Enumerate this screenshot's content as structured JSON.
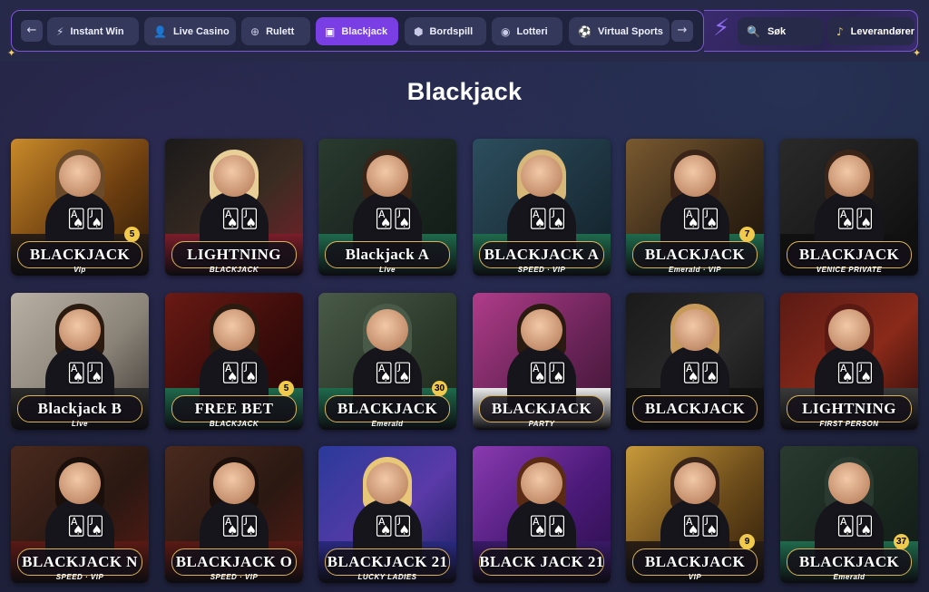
{
  "nav": {
    "prev_arrow": "←",
    "next_arrow": "→",
    "tabs": [
      {
        "label": "Instant Win",
        "icon": "⚡",
        "icon_name": "bolt-icon"
      },
      {
        "label": "Live Casino",
        "icon": "👤",
        "icon_name": "person-icon"
      },
      {
        "label": "Rulett",
        "icon": "⊕",
        "icon_name": "roulette-icon"
      },
      {
        "label": "Blackjack",
        "icon": "▣",
        "icon_name": "cards-icon"
      },
      {
        "label": "Bordspill",
        "icon": "⬢",
        "icon_name": "dice-icon"
      },
      {
        "label": "Lotteri",
        "icon": "◉",
        "icon_name": "lottery-icon"
      },
      {
        "label": "Virtual Sports",
        "icon": "⚽",
        "icon_name": "ball-icon"
      }
    ],
    "active_tab": "Blackjack",
    "accent_color": "#7a3fe4",
    "search": {
      "label": "Søk",
      "icon": "🔍",
      "icon_name": "search-icon"
    },
    "provider": {
      "label": "Leverandører",
      "icon": "♪",
      "icon_name": "provider-icon"
    }
  },
  "page": {
    "title": "Blackjack"
  },
  "games": [
    {
      "title": "BLACKJACK",
      "subtitle": "Vip",
      "badge": "5"
    },
    {
      "title": "LIGHTNING",
      "subtitle": "BLACKJACK",
      "badge": ""
    },
    {
      "title": "Blackjack A",
      "subtitle": "Live",
      "badge": ""
    },
    {
      "title": "BLACKJACK A",
      "subtitle": "SPEED · VIP",
      "badge": ""
    },
    {
      "title": "BLACKJACK",
      "subtitle": "Emerald · VIP",
      "badge": "7"
    },
    {
      "title": "BLACKJACK",
      "subtitle": "VENICE PRIVATE",
      "badge": ""
    },
    {
      "title": "Blackjack B",
      "subtitle": "Live",
      "badge": ""
    },
    {
      "title": "FREE BET",
      "subtitle": "BLACKJACK",
      "badge": "5"
    },
    {
      "title": "BLACKJACK",
      "subtitle": "Emerald",
      "badge": "30"
    },
    {
      "title": "BLACKJACK",
      "subtitle": "PARTY",
      "badge": ""
    },
    {
      "title": "BLACKJACK",
      "subtitle": "",
      "badge": ""
    },
    {
      "title": "LIGHTNING",
      "subtitle": "FIRST PERSON",
      "badge": ""
    },
    {
      "title": "BLACKJACK N",
      "subtitle": "SPEED · VIP",
      "badge": ""
    },
    {
      "title": "BLACKJACK O",
      "subtitle": "SPEED · VIP",
      "badge": ""
    },
    {
      "title": "BLACKJACK 21",
      "subtitle": "LUCKY LADIES",
      "badge": ""
    },
    {
      "title": "BLACK JACK 21",
      "subtitle": "",
      "badge": ""
    },
    {
      "title": "BLACKJACK",
      "subtitle": "VIP",
      "badge": "9"
    },
    {
      "title": "BLACKJACK",
      "subtitle": "Emerald",
      "badge": "37"
    }
  ]
}
